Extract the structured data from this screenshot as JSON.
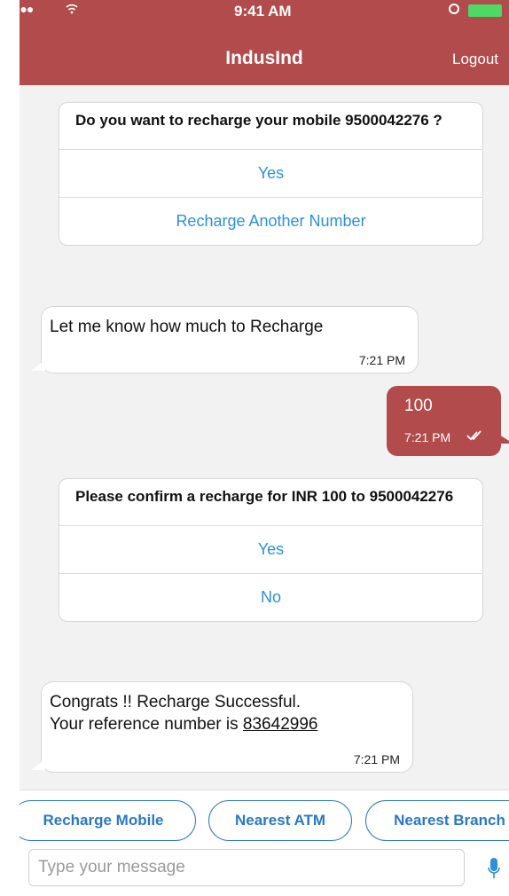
{
  "status_bar": {
    "time": "9:41 AM"
  },
  "header": {
    "title": "IndusInd",
    "logout_label": "Logout"
  },
  "messages": {
    "card1": {
      "question": "Do you want to recharge your mobile 9500042276 ?",
      "options": [
        "Yes",
        "Recharge Another Number"
      ]
    },
    "bot1": {
      "text": "Let me know how much to Recharge",
      "time": "7:21 PM"
    },
    "user1": {
      "text": "100",
      "time": "7:21 PM"
    },
    "card2": {
      "question": "Please confirm a recharge for INR 100 to 9500042276",
      "options": [
        "Yes",
        "No"
      ]
    },
    "bot2": {
      "line1": "Congrats !! Recharge Successful.",
      "line2_prefix": "Your reference number is ",
      "reference": "83642996",
      "time": "7:21 PM"
    }
  },
  "quick_replies": [
    "Recharge Mobile",
    "Nearest ATM",
    "Nearest Branch"
  ],
  "composer": {
    "placeholder": "Type your message"
  },
  "colors": {
    "brand": "#b24b4b",
    "link": "#2e8fd8",
    "chip": "#2a78c2"
  }
}
